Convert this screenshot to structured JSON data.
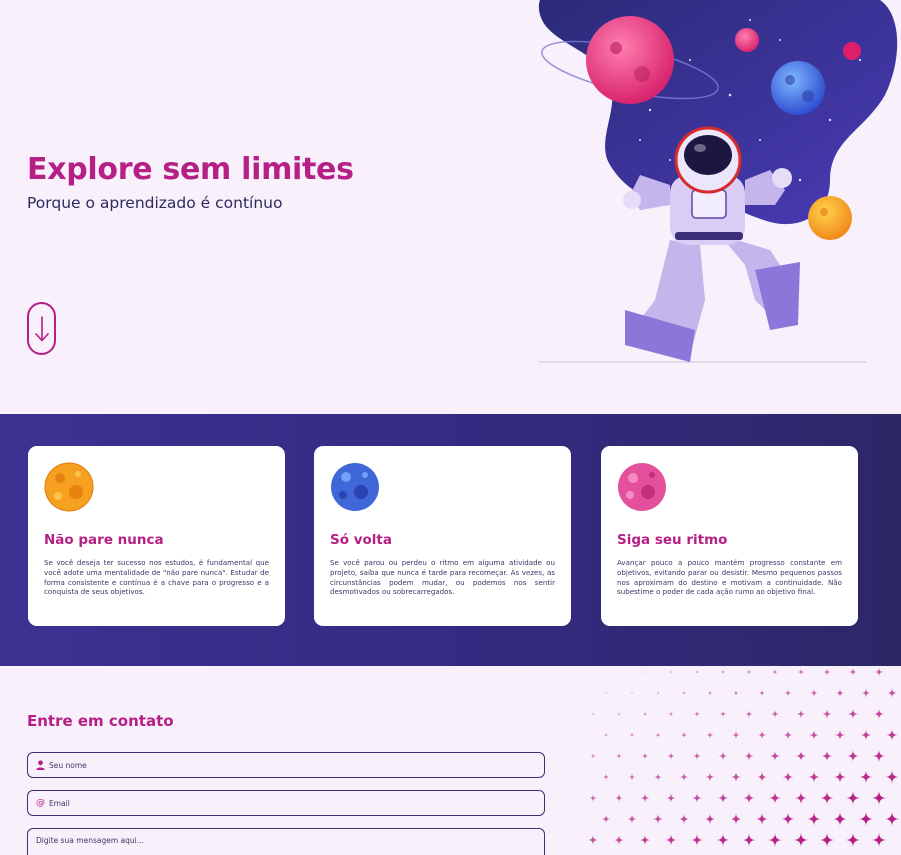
{
  "hero": {
    "title": "Explore sem limites",
    "subtitle": "Porque o aprendizado é contínuo",
    "scroll_icon": "arrow-down-icon",
    "illustration": "astronaut-in-space-illustration"
  },
  "features": {
    "cards": [
      {
        "icon": "orange-planet-icon",
        "title": "Não pare nunca",
        "text": "Se você deseja ter sucesso nos estudos, é fundamental que você adote uma mentalidade de \"não pare nunca\". Estudar de forma consistente e contínua é a chave para o progresso e a conquista de seus objetivos."
      },
      {
        "icon": "blue-planet-icon",
        "title": "Só volta",
        "text": "Se você parou ou perdeu o ritmo em alguma atividade ou projeto, saiba que nunca é tarde para recomeçar. Às vezes, as circunstâncias podem mudar, ou podemos nos sentir desmotivados ou sobrecarregados."
      },
      {
        "icon": "pink-planet-icon",
        "title": "Siga seu ritmo",
        "text": "Avançar pouco a pouco mantém progresso constante em objetivos, evitando parar ou desistir. Mesmo pequenos passos nos aproximam do destino e motivam a continuidade. Não subestime o poder de cada ação rumo ao objetivo final."
      }
    ]
  },
  "contact": {
    "title": "Entre em contato",
    "name_placeholder": "Seu nome",
    "name_icon": "user-icon",
    "email_placeholder": "Email",
    "email_icon": "at-sign-icon",
    "message_placeholder": "Digite sua mensagem aqui..."
  },
  "colors": {
    "accent": "#b51f86",
    "navy": "#2e2a5e",
    "background": "#f8f0fb",
    "band": "#3b3292"
  }
}
